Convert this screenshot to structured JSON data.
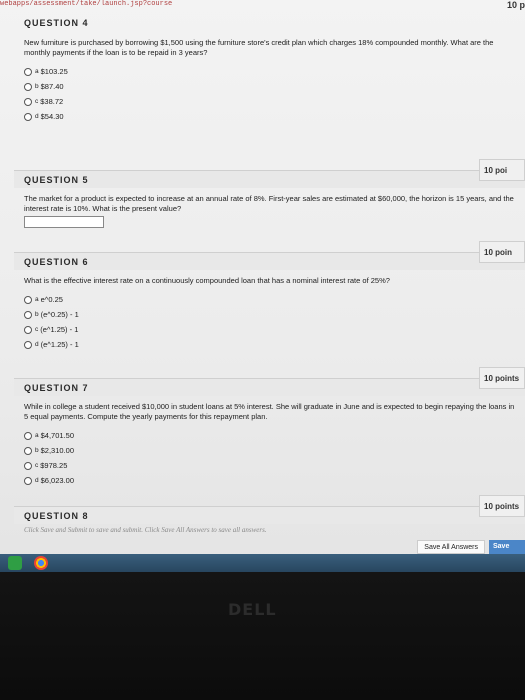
{
  "browser": {
    "url_fragment": "webapps/assessment/take/launch.jsp?course"
  },
  "page_badge": "10 p",
  "questions": [
    {
      "title": "QUESTION 4",
      "points": "",
      "text": "New furniture is purchased by borrowing $1,500 using the furniture store's credit plan which charges 18% compounded monthly. What are the monthly payments if the loan is to be repaid in 3 years?",
      "options": [
        {
          "letter": "a",
          "text": "$103.25"
        },
        {
          "letter": "b",
          "text": "$87.40"
        },
        {
          "letter": "c",
          "text": "$38.72"
        },
        {
          "letter": "d",
          "text": "$54.30"
        }
      ]
    },
    {
      "title": "QUESTION 5",
      "points": "10 poi",
      "text": "The market for a product is expected to increase at an annual rate of 8%. First-year sales are estimated at $60,000, the horizon is 15 years, and the interest rate is 10%. What is the present value?"
    },
    {
      "title": "QUESTION 6",
      "points": "10 poin",
      "text": "What is the effective interest rate on a continuously compounded loan that has a nominal interest rate of 25%?",
      "options": [
        {
          "letter": "a",
          "text": "e^0.25"
        },
        {
          "letter": "b",
          "text": "(e^0.25) - 1"
        },
        {
          "letter": "c",
          "text": "(e^1.25) - 1"
        },
        {
          "letter": "d",
          "text": "(e^1.25) - 1"
        }
      ]
    },
    {
      "title": "QUESTION 7",
      "points": "10 points",
      "text": "While in college a student received $10,000 in student loans at 5% interest. She will graduate in June and is expected to begin repaying the loans in 5 equal payments. Compute the yearly payments for this repayment plan.",
      "options": [
        {
          "letter": "a",
          "text": "$4,701.50"
        },
        {
          "letter": "b",
          "text": "$2,310.00"
        },
        {
          "letter": "c",
          "text": "$978.25"
        },
        {
          "letter": "d",
          "text": "$6,023.00"
        }
      ]
    },
    {
      "title": "QUESTION 8",
      "points": "10 points"
    }
  ],
  "footer": {
    "instruction": "Click Save and Submit to save and submit. Click Save All Answers to save all answers.",
    "save_all_label": "Save All Answers",
    "save_submit_label": "Save"
  },
  "monitor_brand": "DELL",
  "colors": {
    "accent": "#4b86c8",
    "taskbar": "#2f526e"
  }
}
